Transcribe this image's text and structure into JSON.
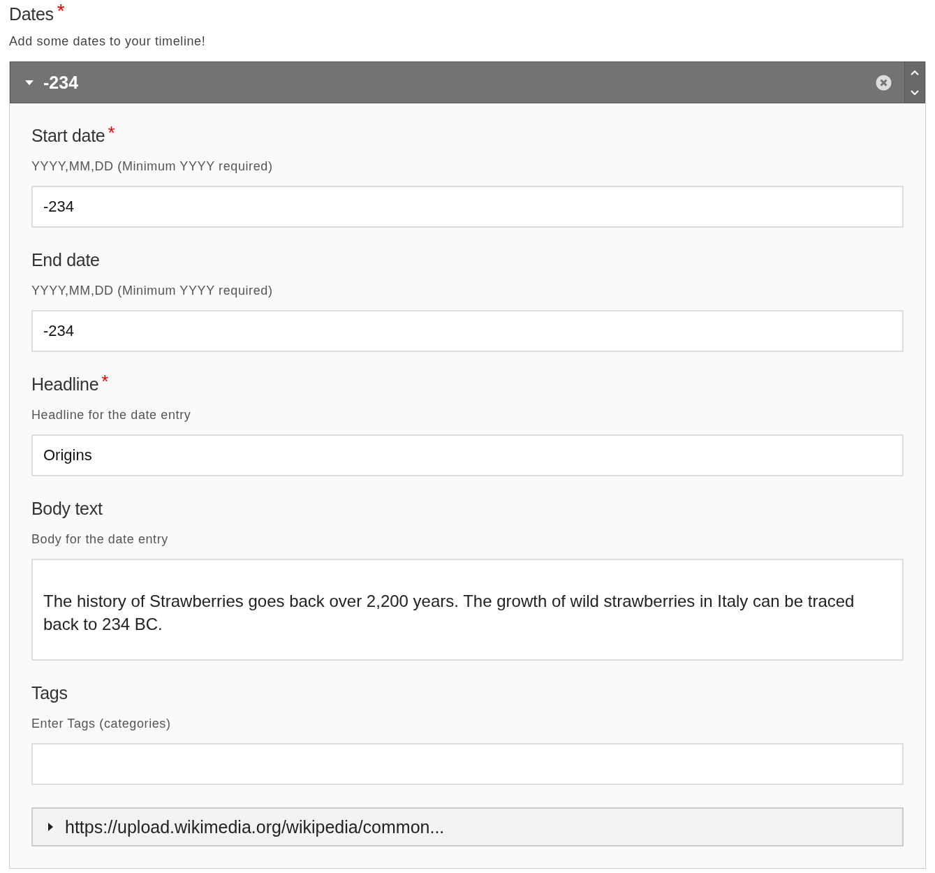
{
  "section": {
    "title": "Dates",
    "required_mark": "*",
    "description": "Add some dates to your timeline!"
  },
  "item": {
    "title": "-234",
    "expanded": true,
    "fields": [
      {
        "kind": "input",
        "label": "Start date",
        "required_mark": "*",
        "hint": "YYYY,MM,DD (Minimum YYYY required)",
        "value": "-234"
      },
      {
        "kind": "input",
        "label": "End date",
        "hint": "YYYY,MM,DD (Minimum YYYY required)",
        "value": "-234"
      },
      {
        "kind": "input",
        "label": "Headline",
        "required_mark": "*",
        "hint": "Headline for the date entry",
        "value": "Origins"
      },
      {
        "kind": "textarea",
        "label": "Body text",
        "hint": "Body for the date entry",
        "value": "The history of Strawberries goes back over 2,200 years. The growth of wild strawberries in Italy can be traced back to 234 BC."
      },
      {
        "kind": "input",
        "label": "Tags",
        "hint": "Enter Tags (categories)"
      }
    ],
    "media": {
      "title": "https://upload.wikimedia.org/wikipedia/common...",
      "expanded": false
    }
  }
}
